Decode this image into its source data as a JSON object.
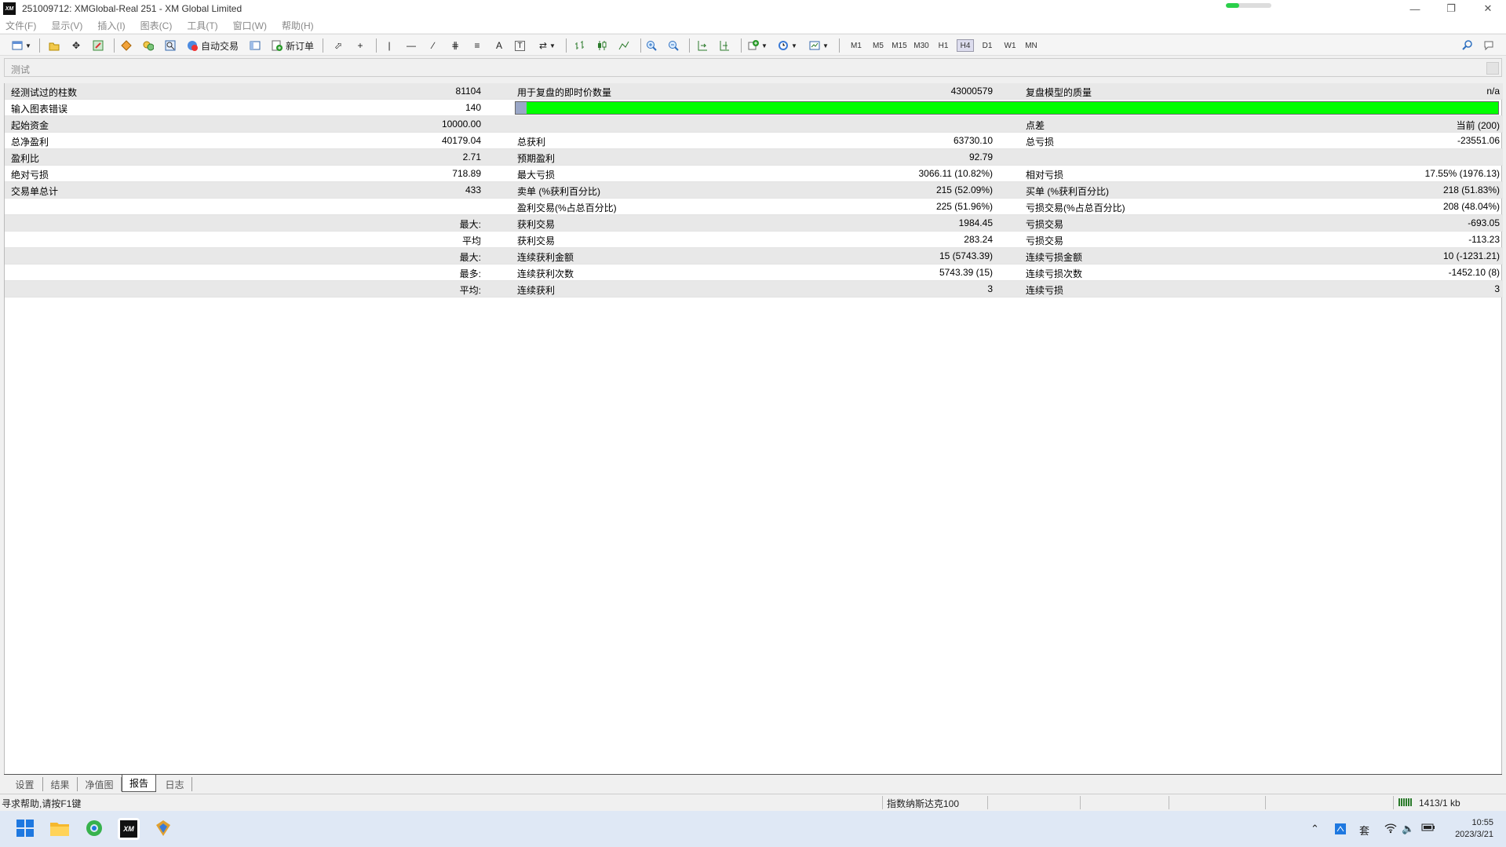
{
  "window": {
    "title": "251009712: XMGlobal-Real 251 - XM Global Limited",
    "logo": "XM",
    "progress_fraction": 0.3
  },
  "menu": [
    "文件(F)",
    "显示(V)",
    "插入(I)",
    "图表(C)",
    "工具(T)",
    "窗口(W)",
    "帮助(H)"
  ],
  "toolbar": {
    "auto_trade_label": "自动交易",
    "new_order_label": "新订单",
    "timeframes": [
      "M1",
      "M5",
      "M15",
      "M30",
      "H1",
      "H4",
      "D1",
      "W1",
      "MN"
    ],
    "active_timeframe": "H4",
    "text_tool_label": "A",
    "text_label_tool": "T"
  },
  "panel": {
    "title": "测试"
  },
  "report": {
    "rows": [
      {
        "c1": "经测试过的柱数",
        "v1": "81104",
        "c2": "用于复盘的即时价数量",
        "v2": "43000579",
        "c3": "复盘模型的质量",
        "v3": "n/a"
      },
      {
        "c1": "输入图表错误",
        "v1": "140",
        "c2": "",
        "v2": "",
        "c3": "",
        "v3": ""
      },
      {
        "c1": "起始资金",
        "v1": "10000.00",
        "c2": "",
        "v2": "",
        "c3": "点差",
        "v3": "当前 (200)"
      },
      {
        "c1": "总净盈利",
        "v1": "40179.04",
        "c2": "总获利",
        "v2": "63730.10",
        "c3": "总亏损",
        "v3": "-23551.06"
      },
      {
        "c1": "盈利比",
        "v1": "2.71",
        "c2": "预期盈利",
        "v2": "92.79",
        "c3": "",
        "v3": ""
      },
      {
        "c1": "绝对亏损",
        "v1": "718.89",
        "c2": "最大亏损",
        "v2": "3066.11 (10.82%)",
        "c3": "相对亏损",
        "v3": "17.55% (1976.13)"
      },
      {
        "c1": "交易单总计",
        "v1": "433",
        "c2": "卖单 (%获利百分比)",
        "v2": "215 (52.09%)",
        "c3": "买单 (%获利百分比)",
        "v3": "218 (51.83%)"
      },
      {
        "c1": "",
        "v1": "",
        "c2": "盈利交易(%占总百分比)",
        "v2": "225 (51.96%)",
        "c3": "亏损交易(%占总百分比)",
        "v3": "208 (48.04%)"
      },
      {
        "c1": "",
        "v1": "最大:",
        "c2": "获利交易",
        "v2": "1984.45",
        "c3": "亏损交易",
        "v3": "-693.05"
      },
      {
        "c1": "",
        "v1": "平均",
        "c2": "获利交易",
        "v2": "283.24",
        "c3": "亏损交易",
        "v3": "-113.23"
      },
      {
        "c1": "",
        "v1": "最大:",
        "c2": "连续获利金额",
        "v2": "15 (5743.39)",
        "c3": "连续亏损金额",
        "v3": "10 (-1231.21)"
      },
      {
        "c1": "",
        "v1": "最多:",
        "c2": "连续获利次数",
        "v2": "5743.39 (15)",
        "c3": "连续亏损次数",
        "v3": "-1452.10 (8)"
      },
      {
        "c1": "",
        "v1": "平均:",
        "c2": "连续获利",
        "v2": "3",
        "c3": "连续亏损",
        "v3": "3"
      }
    ],
    "quality_bar_color": "#00ff00"
  },
  "tabs": [
    "设置",
    "结果",
    "净值图",
    "报告",
    "日志"
  ],
  "active_tab": "报告",
  "status": {
    "help": "寻求帮助,请按F1键",
    "profile": "指数纳斯达克100",
    "traffic": "1413/1 kb"
  },
  "taskbar": {
    "time": "10:55",
    "date": "2023/3/21"
  }
}
